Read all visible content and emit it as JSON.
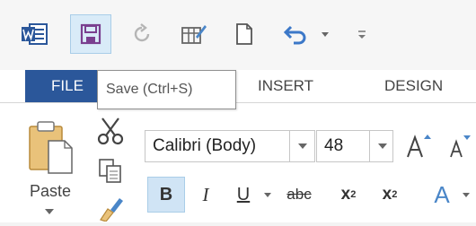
{
  "tabs": {
    "file": "FILE",
    "insert": "INSERT",
    "design": "DESIGN"
  },
  "tooltip": {
    "text": "Save (Ctrl+S)"
  },
  "clipboard": {
    "paste_label": "Paste"
  },
  "font": {
    "name": "Calibri (Body)",
    "size": "48"
  },
  "format": {
    "bold": "B",
    "italic": "I",
    "underline": "U",
    "strikethrough": "abc",
    "subscript_base": "x",
    "subscript_mark": "2",
    "superscript_base": "x",
    "superscript_mark": "2",
    "text_effects": "A"
  },
  "colors": {
    "word_blue": "#2b579a",
    "hover_blue": "#d9ebf8",
    "undo_blue": "#3c78c8",
    "effects_blue": "#4a86c8"
  },
  "icons": {
    "app": "word-logo-icon",
    "save": "floppy-disk-icon",
    "repeat": "repeat-icon",
    "draw": "draw-table-icon",
    "new": "new-document-icon",
    "undo": "undo-icon",
    "customize": "customize-toolbar-icon",
    "paste": "clipboard-icon",
    "cut": "scissors-icon",
    "copy": "copy-icon",
    "format_painter": "paintbrush-icon",
    "grow": "grow-font-icon",
    "shrink": "shrink-font-icon"
  }
}
